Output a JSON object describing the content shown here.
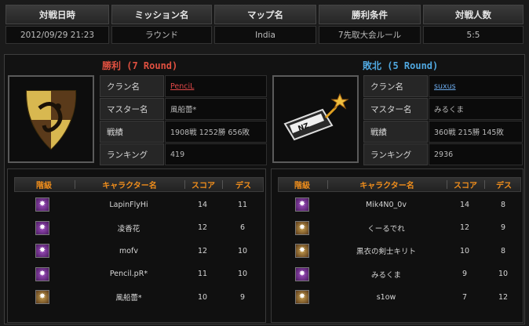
{
  "match_info": {
    "headers": [
      "対戦日時",
      "ミッション名",
      "マップ名",
      "勝利条件",
      "対戦人数"
    ],
    "values": [
      "2012/09/29 21:23",
      "ラウンド",
      "India",
      "7先取大会ルール",
      "5:5"
    ]
  },
  "winner": {
    "title": "勝利 (7 Round)",
    "labels": [
      "クラン名",
      "マスター名",
      "戦績",
      "ランキング"
    ],
    "clan": "PenciL",
    "master": "風船蕾*",
    "record": "1908戦 1252勝 656敗",
    "ranking": "419",
    "emblem_icon": "shield-emblem-icon"
  },
  "loser": {
    "title": "敗北 (5 Round)",
    "labels": [
      "クラン名",
      "マスター名",
      "戦績",
      "ランキング"
    ],
    "clan": "suxus",
    "master": "みるくま",
    "record": "360戦 215勝 145敗",
    "ranking": "2936",
    "emblem_icon": "arrow-emblem-icon"
  },
  "table_headers": [
    "階級",
    "キャラクター名",
    "スコア",
    "デス"
  ],
  "winner_players": [
    {
      "rank_icon": "purple",
      "name": "LapinFlyHi",
      "score": "14",
      "death": "11"
    },
    {
      "rank_icon": "purple",
      "name": "凌香花",
      "score": "12",
      "death": "6"
    },
    {
      "rank_icon": "purple",
      "name": "mofv",
      "score": "12",
      "death": "10"
    },
    {
      "rank_icon": "purple",
      "name": "Pencil.pR*",
      "score": "11",
      "death": "10"
    },
    {
      "rank_icon": "gold",
      "name": "風船蕾*",
      "score": "10",
      "death": "9"
    }
  ],
  "loser_players": [
    {
      "rank_icon": "purple",
      "name": "Mik4N0_0v",
      "score": "14",
      "death": "8"
    },
    {
      "rank_icon": "gold",
      "name": "くーるでれ",
      "score": "12",
      "death": "9"
    },
    {
      "rank_icon": "gold",
      "name": "黒衣の剣士キリト",
      "score": "10",
      "death": "8"
    },
    {
      "rank_icon": "purple",
      "name": "みるくま",
      "score": "9",
      "death": "10"
    },
    {
      "rank_icon": "gold",
      "name": "s1ow",
      "score": "7",
      "death": "12"
    }
  ]
}
